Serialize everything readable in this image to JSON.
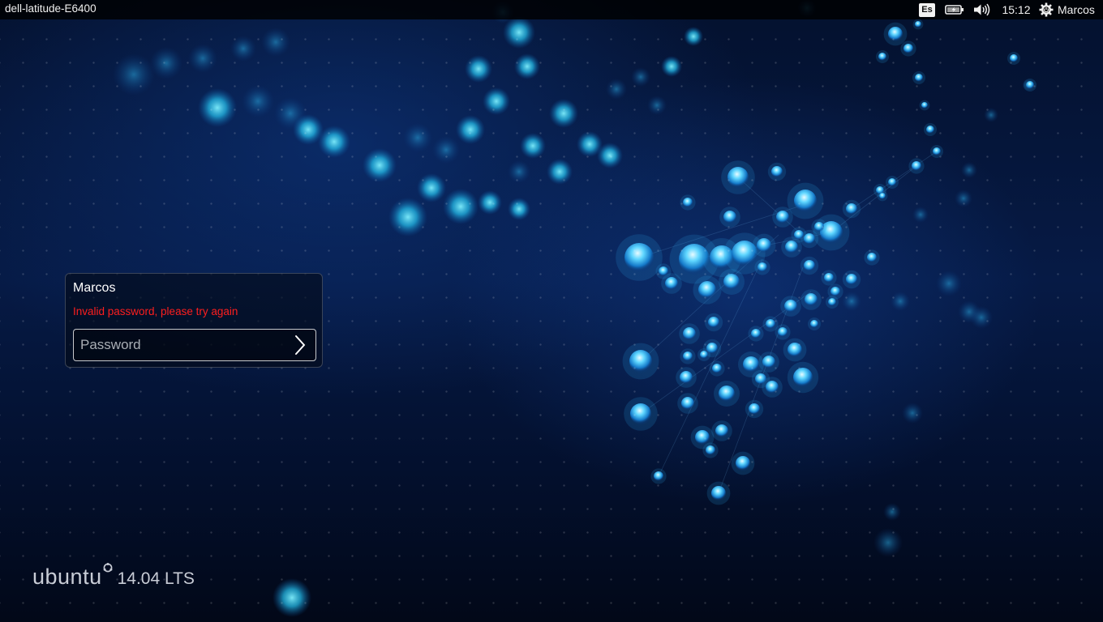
{
  "top_panel": {
    "hostname": "dell-latitude-E6400",
    "keyboard_layout": "Es",
    "clock": "15:12",
    "session_user": "Marcos",
    "icons": {
      "battery": "battery-plugged-icon",
      "sound": "speaker-volume-icon",
      "session": "gear-power-icon"
    }
  },
  "login": {
    "user_name": "Marcos",
    "error_message": "Invalid password, please try again",
    "password_placeholder": "Password",
    "password_value": "",
    "submit_icon": "chevron-right-icon"
  },
  "branding": {
    "wordmark": "ubuntu",
    "version": "14.04 LTS"
  },
  "colors": {
    "error": "#ff1e1e",
    "panel_bg": "#000000",
    "wallpaper_base": "#061a45",
    "droplet": "#3fc9ff"
  }
}
